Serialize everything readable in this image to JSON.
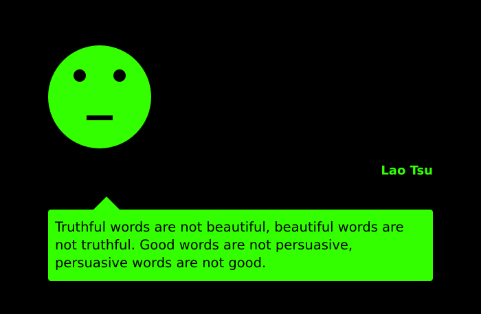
{
  "colors": {
    "background": "#000000",
    "accent": "#33ff00",
    "ink": "#000000"
  },
  "avatar": {
    "icon": "neutral-face-icon"
  },
  "author": {
    "name": "Lao Tsu"
  },
  "quote": {
    "text": "Truthful words are not beautiful, beautiful words are not truthful. Good words are not persuasive, persuasive words are not good."
  }
}
